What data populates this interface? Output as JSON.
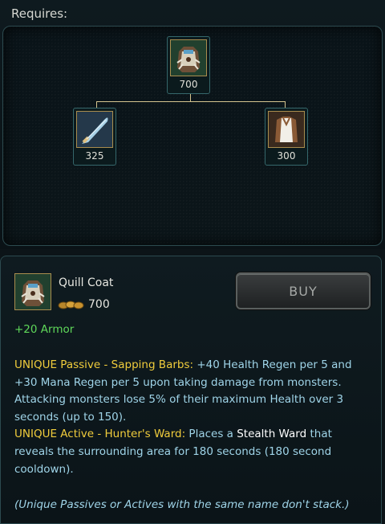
{
  "requires": {
    "title": "Requires:",
    "root": {
      "name": "quill-coat-icon",
      "cost": "700"
    },
    "children": [
      {
        "name": "hunters-machete-icon",
        "cost": "325"
      },
      {
        "name": "cloth-armor-icon",
        "cost": "300"
      }
    ]
  },
  "item": {
    "name": "Quill Coat",
    "icon": "quill-coat-icon",
    "cost": "700",
    "buy_label": "BUY",
    "stat": "+20 Armor",
    "passive_label": "UNIQUE Passive - Sapping Barbs:",
    "passive_text": " +40 Health Regen per 5 and +30 Mana Regen per 5 upon taking damage from monsters. Attacking monsters lose 5% of their maximum Health over 3 seconds (up to 150).",
    "active_label": "UNIQUE Active - Hunter's Ward:",
    "active_text_1": " Places a ",
    "active_highlight": "Stealth Ward",
    "active_text_2": " that reveals the surrounding area for 180 seconds (180 second cooldown).",
    "note": "(Unique Passives or Actives with the same name don't stack.)"
  },
  "colors": {
    "gold": "#f0cc3c",
    "stat_green": "#5fd85a",
    "desc_blue": "#9fd4e8",
    "frame_teal": "#2c4a4f"
  }
}
